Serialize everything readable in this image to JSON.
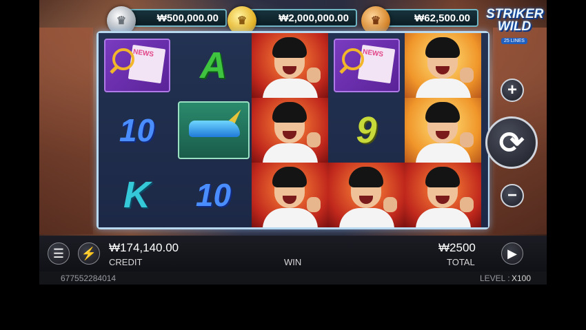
{
  "jackpots": [
    {
      "tier": "silver",
      "amount": "₩500,000.00"
    },
    {
      "tier": "gold",
      "amount": "₩2,000,000.00"
    },
    {
      "tier": "bronze",
      "amount": "₩62,500.00"
    }
  ],
  "logo": {
    "line1": "STRIKER",
    "line2": "WILD",
    "tagline": "25 LINES"
  },
  "reels": [
    [
      "news-scatter",
      "10",
      "K"
    ],
    [
      "A",
      "golden-boot",
      "10"
    ],
    [
      "player-wild",
      "player-wild",
      "player-wild"
    ],
    [
      "news-scatter",
      "9",
      "player-wild"
    ],
    [
      "player-wild-gold",
      "player-wild-gold",
      "player-wild"
    ]
  ],
  "news_text": "NEWS",
  "controls": {
    "plus": "+",
    "minus": "−",
    "spin_icon": "refresh-icon"
  },
  "bottom": {
    "credit_value": "₩174,140.00",
    "credit_label": "CREDIT",
    "win_label": "WIN",
    "total_value": "₩2500",
    "total_label": "TOTAL"
  },
  "info": {
    "session_id": "677552284014",
    "level_label": "LEVEL :",
    "level_value": "X100"
  }
}
